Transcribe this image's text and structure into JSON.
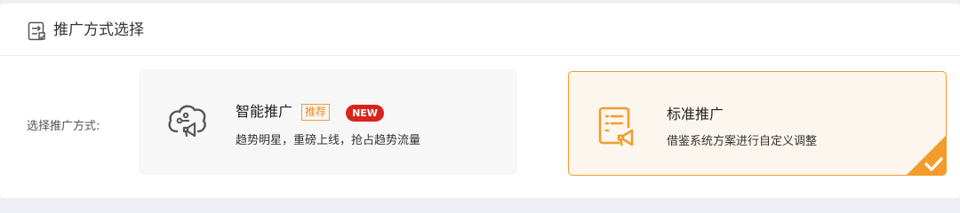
{
  "header": {
    "icon": "switch-icon",
    "title": "推广方式选择"
  },
  "form": {
    "label": "选择推广方式:"
  },
  "options": [
    {
      "key": "smart",
      "icon": "cloud-megaphone-icon",
      "title": "智能推广",
      "tag": "推荐",
      "badge": "NEW",
      "description": "趋势明星，重磅上线，抢占趋势流量",
      "selected": false
    },
    {
      "key": "standard",
      "icon": "document-megaphone-icon",
      "title": "标准推广",
      "description": "借鉴系统方案进行自定义调整",
      "selected": true
    }
  ],
  "colors": {
    "accent": "#f39c2c",
    "badge": "#d9241c",
    "selected_bg": "#fdf6ee",
    "unselected_bg": "#f7f7f7"
  }
}
